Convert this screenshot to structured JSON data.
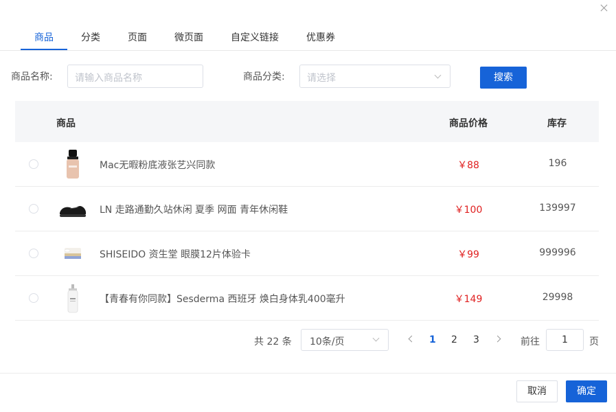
{
  "tabs": [
    {
      "label": "商品"
    },
    {
      "label": "分类"
    },
    {
      "label": "页面"
    },
    {
      "label": "微页面"
    },
    {
      "label": "自定义链接"
    },
    {
      "label": "优惠券"
    }
  ],
  "active_tab": "商品",
  "filters": {
    "name_label": "商品名称:",
    "name_placeholder": "请输入商品名称",
    "category_label": "商品分类:",
    "category_placeholder": "请选择",
    "search_button": "搜索"
  },
  "table": {
    "headers": {
      "product": "商品",
      "price": "商品价格",
      "stock": "库存"
    },
    "rows": [
      {
        "name": "Mac无暇粉底液张艺兴同款",
        "price": "￥88",
        "stock": "196",
        "image": "foundation-bottle"
      },
      {
        "name": "LN 走路通勤久站休闲 夏季 网面 青年休闲鞋",
        "price": "￥100",
        "stock": "139997",
        "image": "black-sneaker"
      },
      {
        "name": "SHISEIDO 资生堂 眼膜12片体验卡",
        "price": "￥99",
        "stock": "999996",
        "image": "eye-mask-card"
      },
      {
        "name": "【青春有你同款】Sesderma 西班牙 焕白身体乳400毫升",
        "price": "￥149",
        "stock": "29998",
        "image": "lotion-bottle"
      }
    ]
  },
  "pagination": {
    "total_text": "共 22 条",
    "page_size": "10条/页",
    "pages": [
      "1",
      "2",
      "3"
    ],
    "current_page": "1",
    "goto_label": "前往",
    "goto_value": "1",
    "goto_suffix": "页"
  },
  "footer": {
    "cancel": "取消",
    "confirm": "确定"
  },
  "colors": {
    "accent": "#1663d8",
    "price": "#e02020"
  }
}
